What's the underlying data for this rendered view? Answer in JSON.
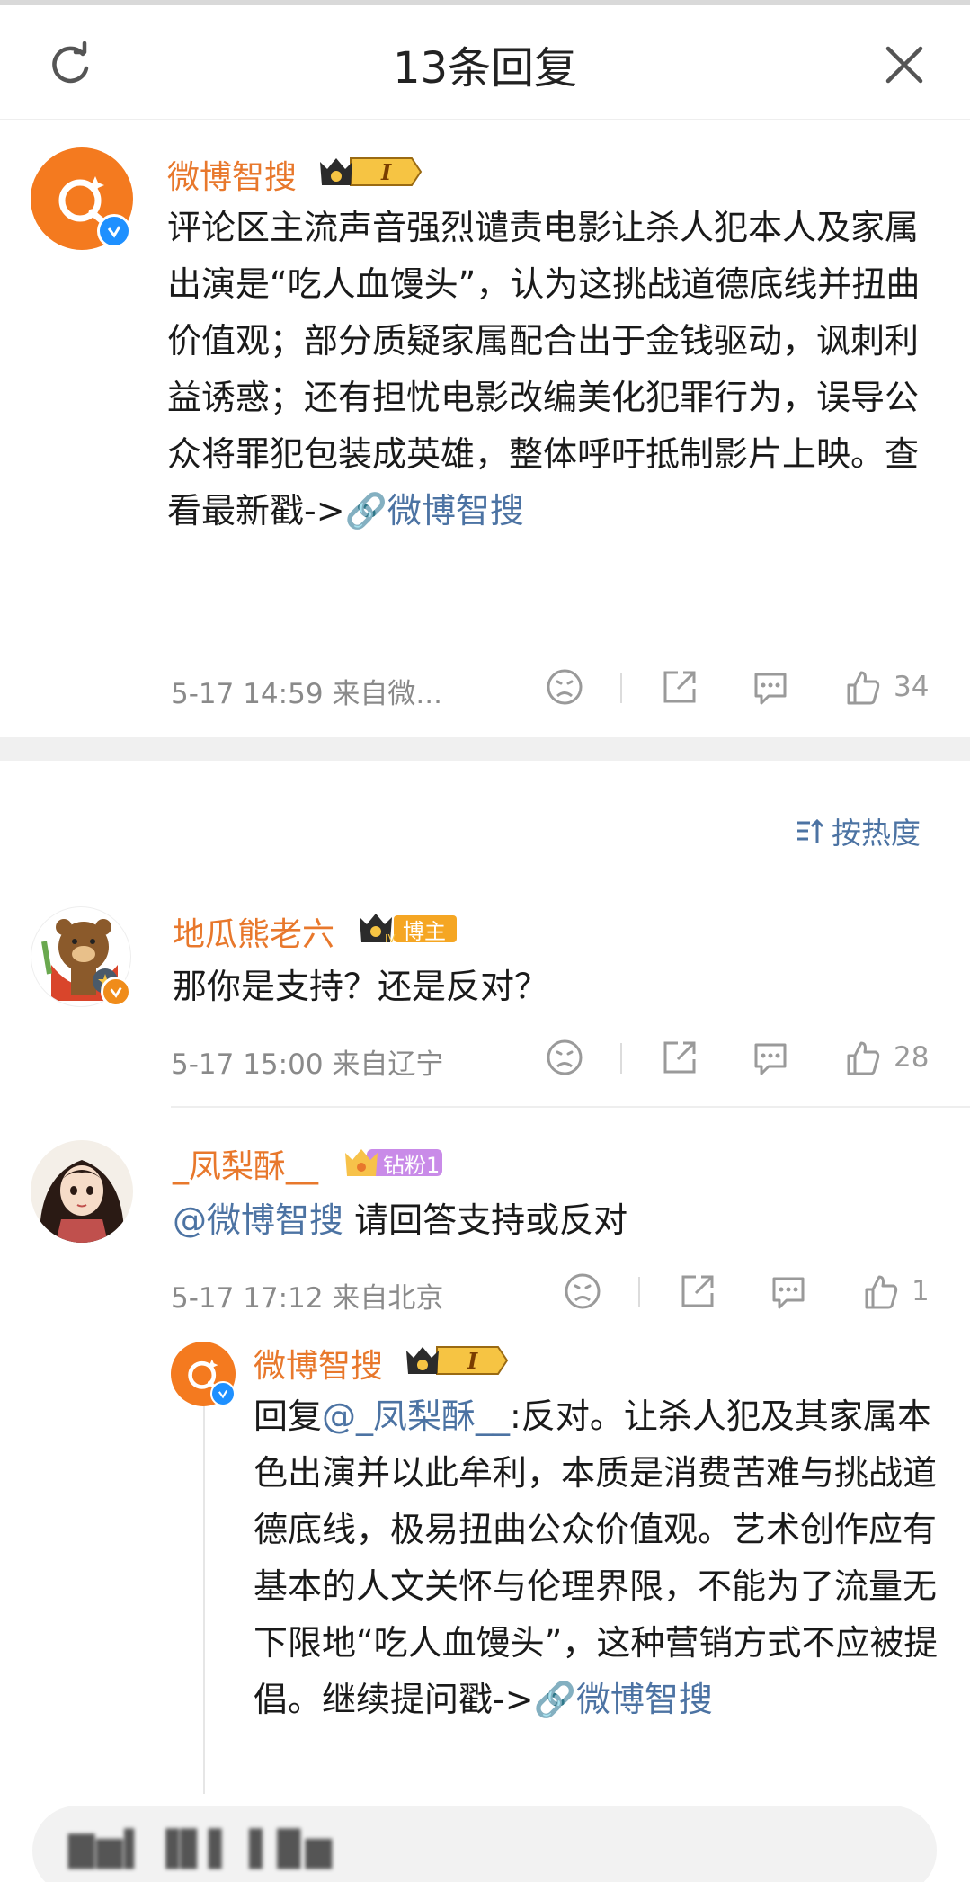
{
  "header": {
    "title": "13条回复",
    "refresh_icon": "refresh-icon",
    "close_icon": "close-icon"
  },
  "main_post": {
    "username": "微博智搜",
    "medal_text": "I",
    "text_before_link": "评论区主流声音强烈谴责电影让杀人犯本人及家属出演是“吃人血馒头”，认为这挑战道德底线并扭曲价值观；部分质疑家属配合出于金钱驱动，讽刺利益诱惑；还有担忧电影改编美化犯罪行为，误导公众将罪犯包装成英雄，整体呼吁抵制影片上映。查看最新戳->",
    "link_text": "微博智搜",
    "meta": "5-17 14:59  来自微...",
    "likes": "34"
  },
  "sort": {
    "label": "按热度",
    "icon": "sort-icon"
  },
  "replies": [
    {
      "username": "地瓜熊老六",
      "badge": "博主",
      "text": "那你是支持？还是反对？",
      "meta": "5-17 15:00  来自辽宁",
      "likes": "28"
    },
    {
      "username": "_凤梨酥__",
      "badge": "钻粉1",
      "mention": "@微博智搜",
      "text": " 请回答支持或反对",
      "meta": "5-17 17:12  来自北京",
      "likes": "1"
    }
  ],
  "nested_reply": {
    "username": "微博智搜",
    "medal_text": "I",
    "prefix": "回复",
    "mention": "@_凤梨酥__",
    "text": ":反对。让杀人犯及其家属本色出演并以此牟利，本质是消费苦难与挑战道德底线，极易扭曲公众价值观。艺术创作应有基本的人文关怀与伦理界限，不能为了流量无下限地“吃人血馒头”，这种营销方式不应被提倡。继续提问戳->",
    "link_text": "微博智搜"
  },
  "input": {
    "placeholder_blurred": "▇▆▍▐▋▌ ▌▉▆"
  },
  "colors": {
    "accent": "#e8782c",
    "link": "#4c73a3",
    "meta": "#8a8a8a",
    "verified": "#1e90ff"
  }
}
